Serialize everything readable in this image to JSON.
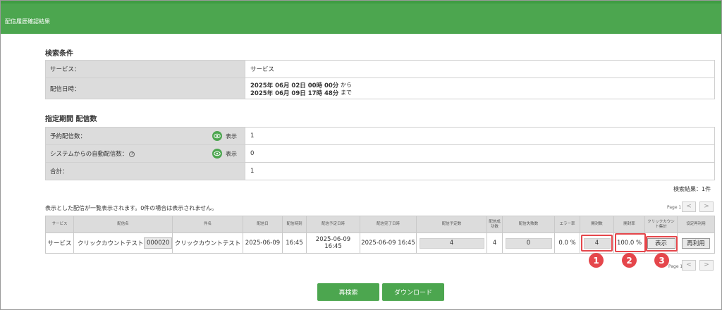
{
  "header": {
    "title": "配信履歴確認結果"
  },
  "search_conditions": {
    "title": "検索条件",
    "rows": [
      {
        "label": "サービス：",
        "value": "サービス"
      },
      {
        "label": "配信日時：",
        "from_date": "2025年 06月 02日 00時 00分",
        "from_suffix": "から",
        "to_date": "2025年 06月 09日 17時 48分",
        "to_suffix": "まで"
      }
    ]
  },
  "period_counts": {
    "title": "指定期間 配信数",
    "rows": [
      {
        "label": "予約配信数：",
        "show": "表示",
        "value": "1"
      },
      {
        "label": "システムからの自動配信数：",
        "help": "?",
        "show": "表示",
        "value": "0"
      },
      {
        "label": "合計：",
        "value": "1"
      }
    ]
  },
  "results": {
    "count_text": "検索結果：1件",
    "note": "表示とした配信が一覧表示されます。0件の場合は表示されません。",
    "page_label": "Page 1",
    "prev": "<",
    "next": ">",
    "columns": [
      "サービス",
      "配信名",
      "件名",
      "配信日",
      "配信時刻",
      "配信予定日時",
      "配信完了日時",
      "配信予定数",
      "配信成功数",
      "配信失敗数",
      "エラー率",
      "開封数",
      "開封率",
      "クリックカウント集計",
      "设定再利用"
    ],
    "row": {
      "service": "サービス",
      "delivery_name": "クリックカウントテスト",
      "code": "000020",
      "subject": "クリックカウントテスト",
      "date": "2025-06-09",
      "time": "16:45",
      "scheduled": "2025-06-09 16:45",
      "completed": "2025-06-09 16:45",
      "planned": "4",
      "success": "4",
      "failed": "0",
      "error_rate": "0.0 %",
      "opens": "4",
      "open_rate": "100.0 %",
      "click_show": "表示",
      "reuse": "再利用"
    }
  },
  "badges": [
    "1",
    "2",
    "3"
  ],
  "actions": {
    "research": "再検索",
    "download": "ダウンロード"
  },
  "colors": {
    "header": "#4ca64f",
    "highlight": "#e5464b",
    "label_bg": "#dcdcdc"
  }
}
